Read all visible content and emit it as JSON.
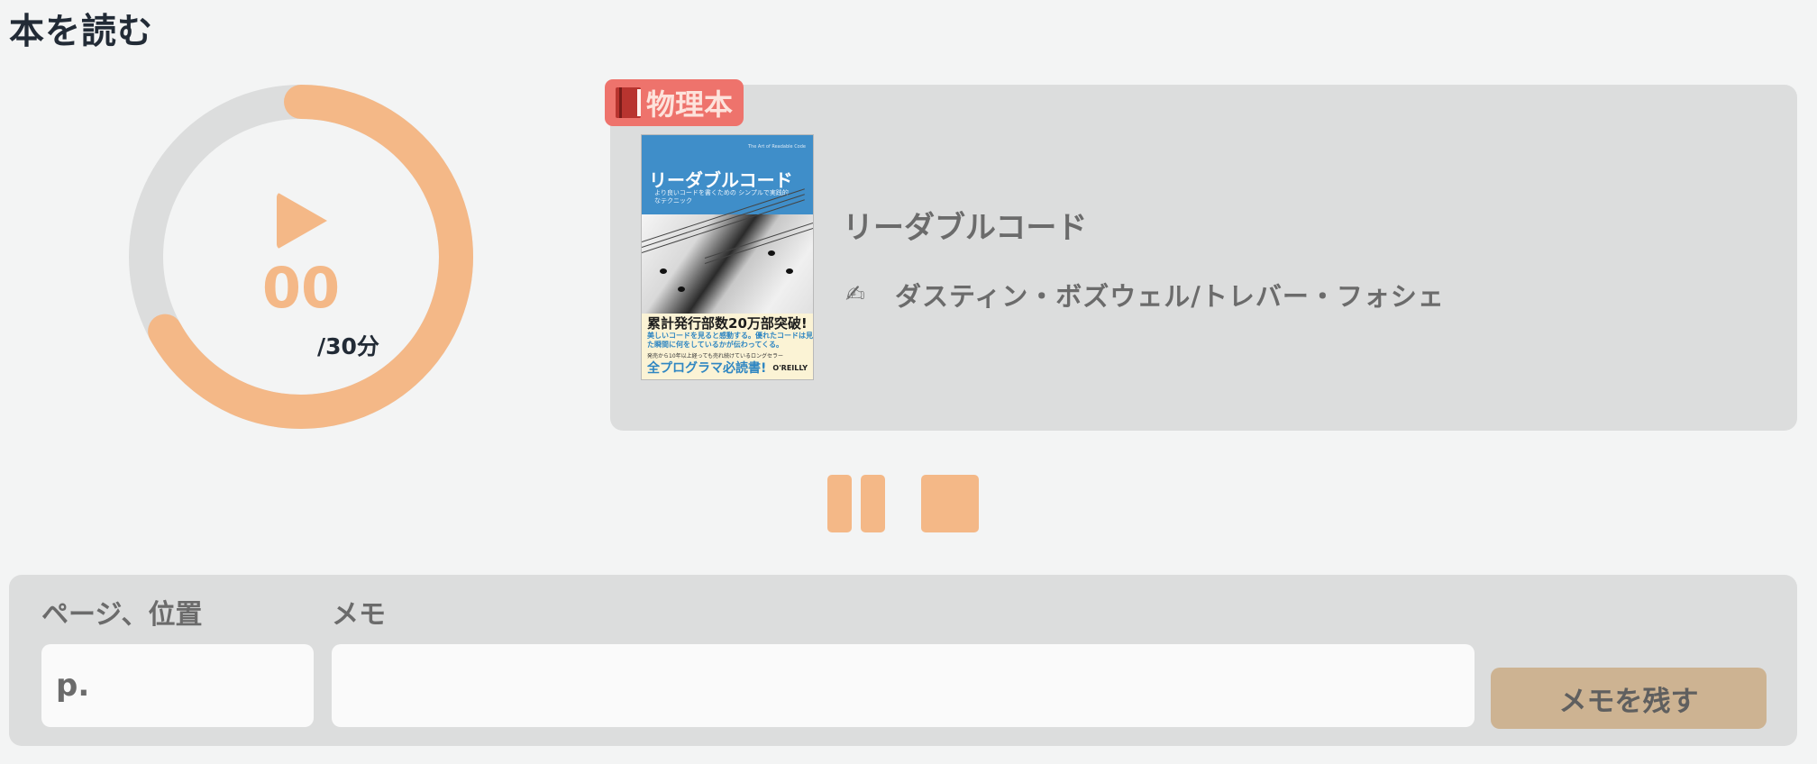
{
  "page": {
    "title": "本を読む"
  },
  "timer": {
    "elapsed": "00",
    "goal": "/30分",
    "progress_fraction": 0.67,
    "colors": {
      "track": "#dcdddd",
      "progress": "#f4b887"
    },
    "play_icon": "play-icon"
  },
  "book": {
    "type_badge": "物理本",
    "type_icon": "red-book-icon",
    "title": "リーダブルコード",
    "author": "ダスティン・ボズウェル/トレバー・フォシェ",
    "author_icon": "pen-icon",
    "cover": {
      "small_text": "The Art of Readable Code",
      "title": "リーダブルコード",
      "subtitle": "より良いコードを書くための シンプルで実践的なテクニック",
      "headline": "累計発行部数20万部突破!",
      "description": "美しいコードを見ると感動する。優れたコードは見た瞬間に何をしているかが伝わってくる。",
      "note": "発売から10年以上経っても売れ続けているロングセラー",
      "tagline": "全プログラマ必読書!",
      "publisher": "O'REILLY"
    }
  },
  "controls": {
    "pause_icon": "pause-icon",
    "stop_icon": "stop-icon"
  },
  "memo": {
    "page_label": "ページ、位置",
    "page_placeholder": "p.",
    "memo_label": "メモ",
    "memo_value": "",
    "save_label": "メモを残す"
  },
  "colors": {
    "background": "#f3f4f4",
    "accent": "#f4b887",
    "badge": "#ee736c",
    "save_button": "#cdb392",
    "panel": "#dcdddd"
  }
}
